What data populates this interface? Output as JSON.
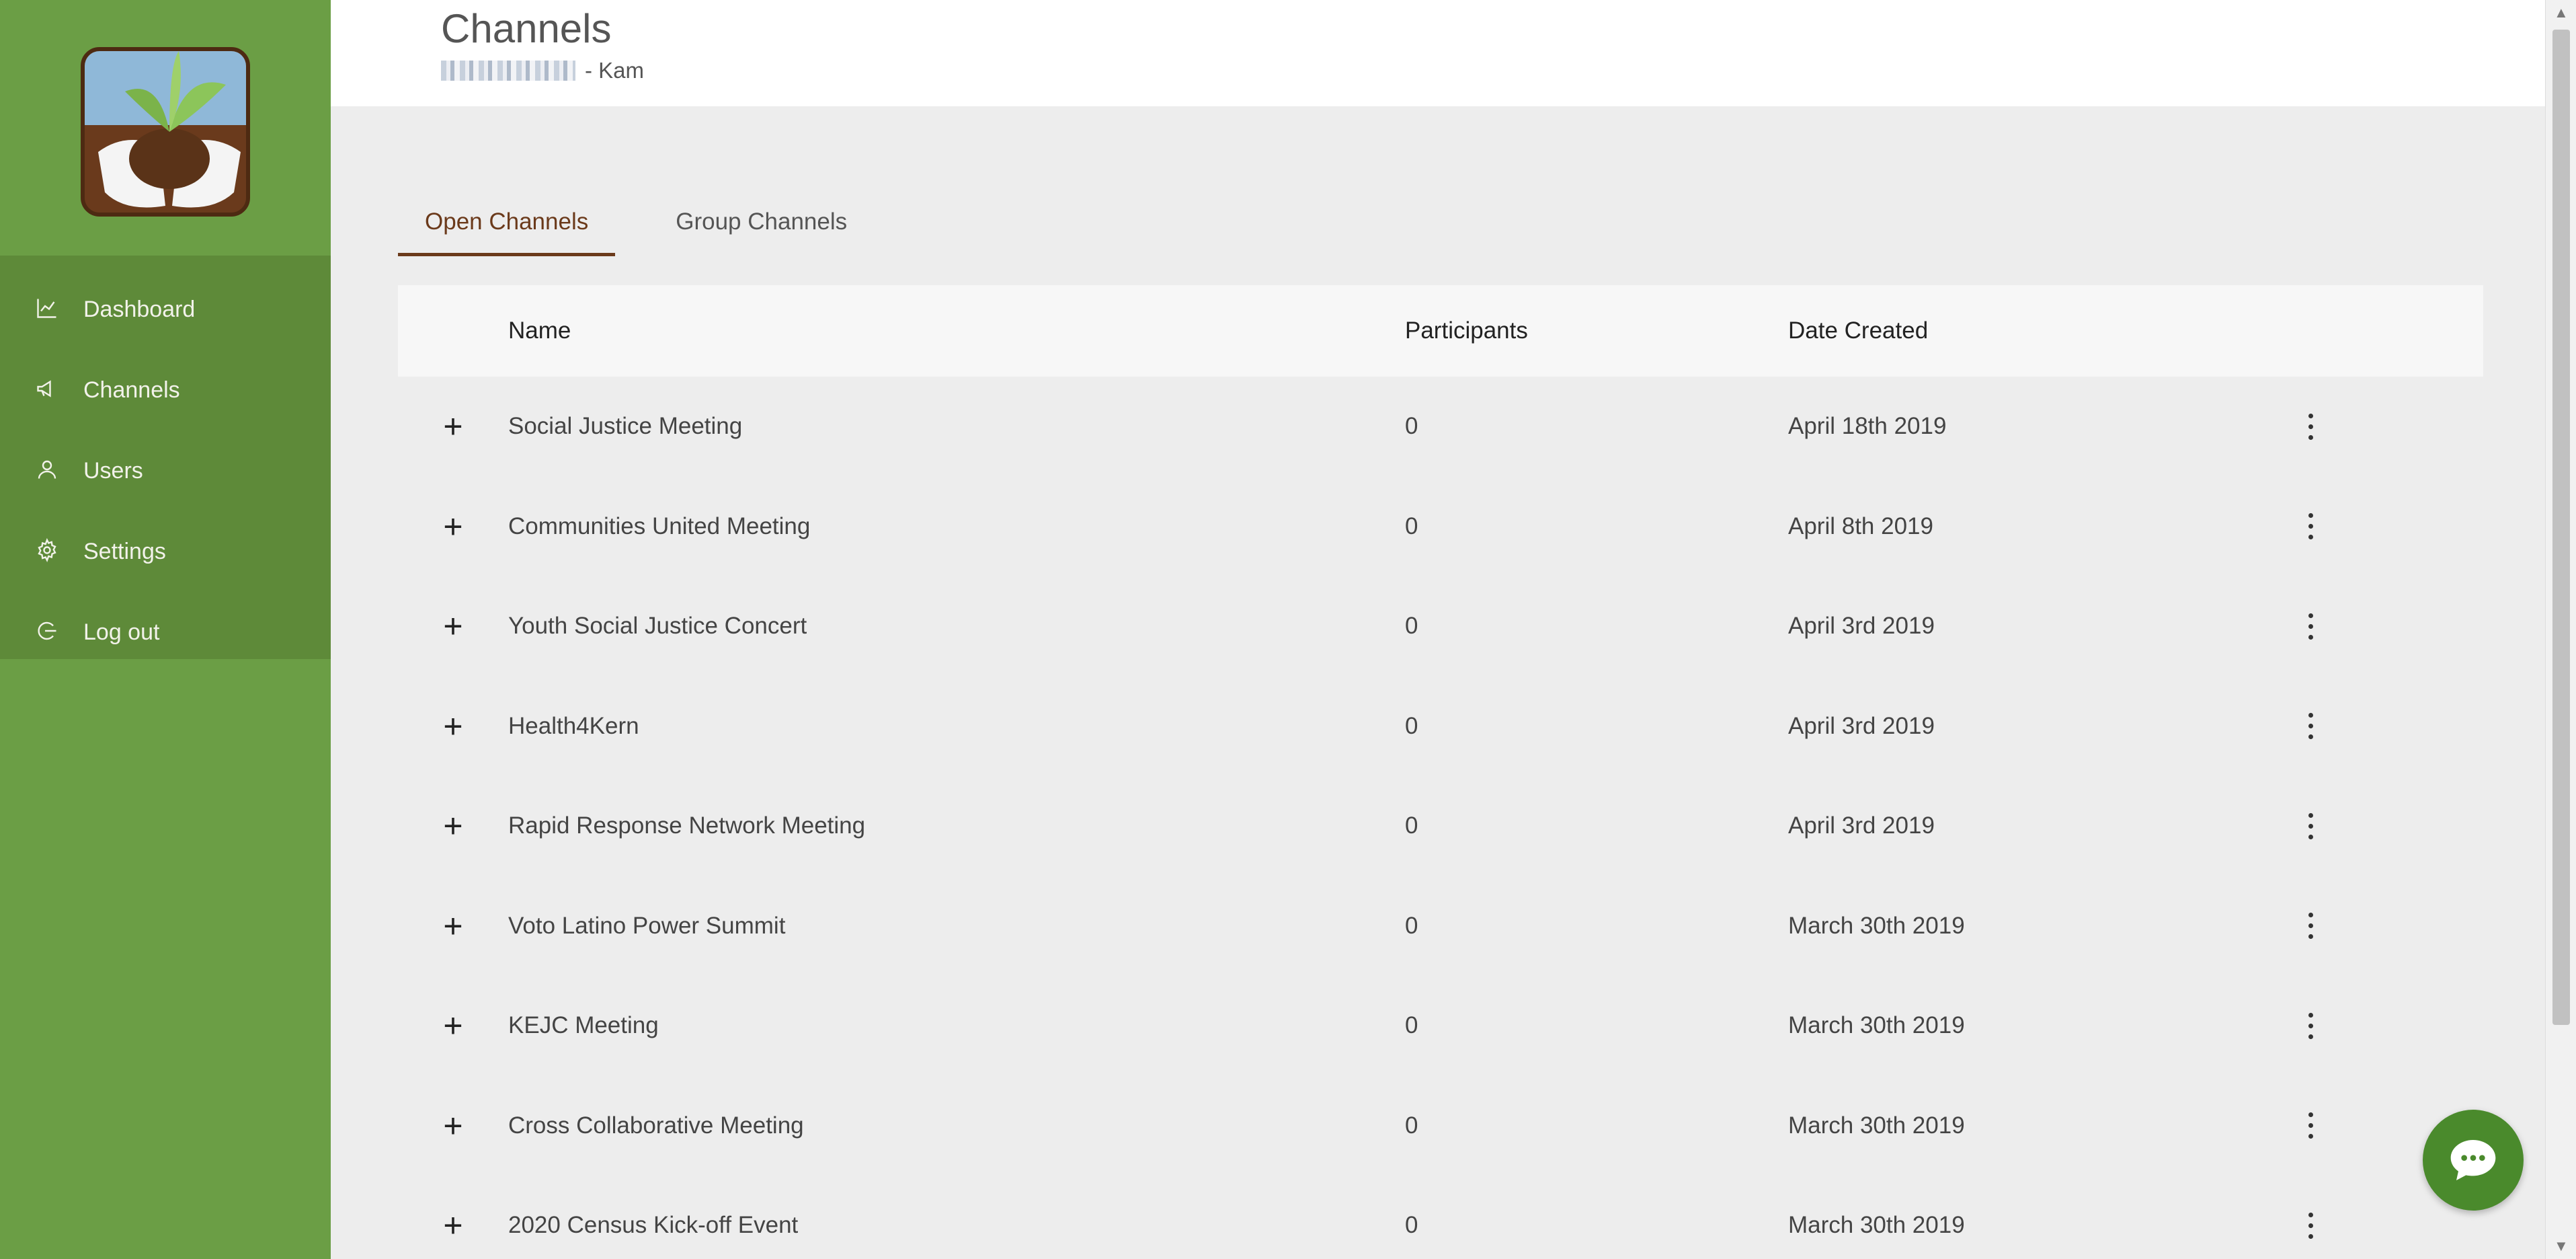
{
  "app": {
    "accent": "#6b3a1b",
    "sidebar_color": "#6b9e45",
    "chat_color": "#4a8a2c"
  },
  "sidebar": {
    "logo": "logo-hands-plant",
    "items": [
      {
        "label": "Dashboard",
        "icon": "line-chart-icon"
      },
      {
        "label": "Channels",
        "icon": "megaphone-icon"
      },
      {
        "label": "Users",
        "icon": "user-icon"
      },
      {
        "label": "Settings",
        "icon": "gear-icon"
      },
      {
        "label": "Log out",
        "icon": "logout-icon"
      }
    ]
  },
  "header": {
    "title": "Channels",
    "subtitle": "- Kam"
  },
  "tabs": [
    {
      "label": "Open Channels",
      "active": true
    },
    {
      "label": "Group Channels",
      "active": false
    }
  ],
  "table": {
    "columns": {
      "name": "Name",
      "participants": "Participants",
      "date": "Date Created"
    },
    "rows": [
      {
        "name": "Social Justice Meeting",
        "participants": "0",
        "date": "April 18th 2019"
      },
      {
        "name": "Communities United Meeting",
        "participants": "0",
        "date": "April 8th 2019"
      },
      {
        "name": "Youth Social Justice Concert",
        "participants": "0",
        "date": "April 3rd 2019"
      },
      {
        "name": "Health4Kern",
        "participants": "0",
        "date": "April 3rd 2019"
      },
      {
        "name": "Rapid Response Network Meeting",
        "participants": "0",
        "date": "April 3rd 2019"
      },
      {
        "name": "Voto Latino Power Summit",
        "participants": "0",
        "date": "March 30th 2019"
      },
      {
        "name": "KEJC Meeting",
        "participants": "0",
        "date": "March 30th 2019"
      },
      {
        "name": "Cross Collaborative Meeting",
        "participants": "0",
        "date": "March 30th 2019"
      },
      {
        "name": "2020 Census Kick-off Event",
        "participants": "0",
        "date": "March 30th 2019"
      }
    ]
  }
}
